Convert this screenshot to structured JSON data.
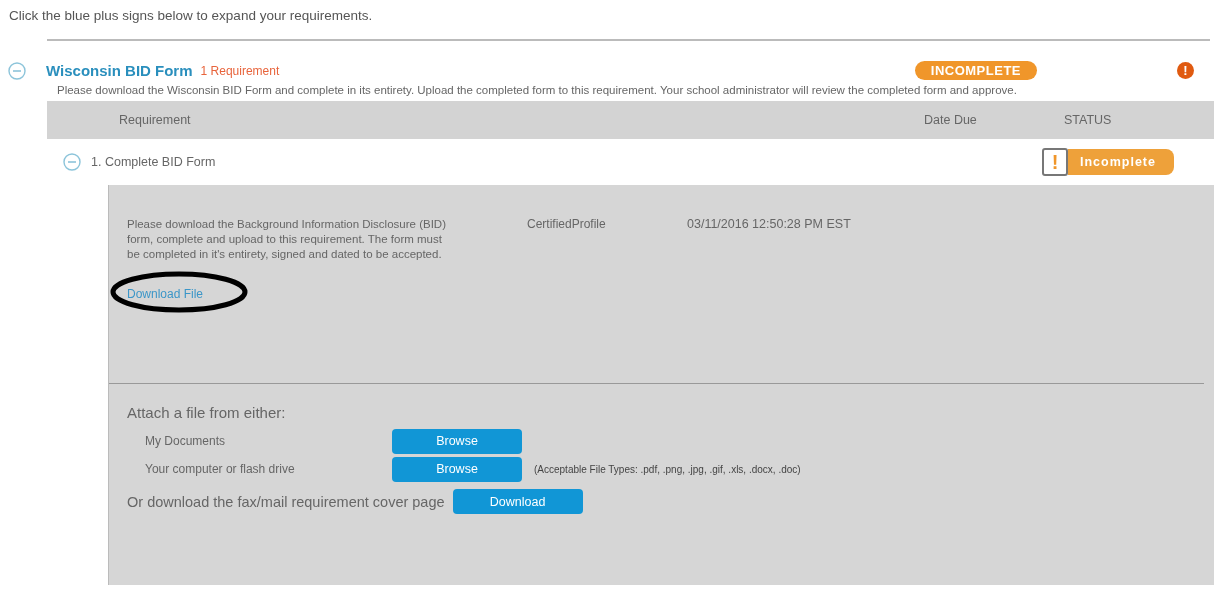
{
  "instruction": "Click the blue plus signs below to expand your requirements.",
  "section": {
    "expanded": true,
    "title": "Wisconsin BID Form",
    "count": "1 Requirement",
    "status": "INCOMPLETE",
    "alert": "!",
    "description": "Please download the Wisconsin BID Form and complete in its entirety. Upload the completed form to this requirement. Your school administrator will review the completed form and approve."
  },
  "table": {
    "columns": [
      "Requirement",
      "Date Due",
      "STATUS"
    ],
    "rows": [
      {
        "expanded": true,
        "name": "1. Complete BID Form",
        "status_icon": "!",
        "status": "Incomplete",
        "detail": {
          "text": "Please download the Background Information Disclosure (BID) form, complete and upload to this requirement. The form must be completed in it's entirety, signed and dated to be accepted.",
          "source": "CertifiedProfile",
          "timestamp": "03/11/2016 12:50:28 PM EST",
          "download_link": {
            "label": "Download File",
            "circled": true
          }
        }
      }
    ]
  },
  "attach": {
    "heading": "Attach a file from either:",
    "sources": [
      {
        "label": "My Documents",
        "button": "Browse"
      },
      {
        "label": "Your computer or flash drive",
        "button": "Browse",
        "note": "(Acceptable File Types: .pdf, .png, .jpg, .gif, .xls, .docx, .doc)"
      }
    ],
    "fax_text": "Or download the fax/mail requirement cover page",
    "fax_button": "Download"
  }
}
